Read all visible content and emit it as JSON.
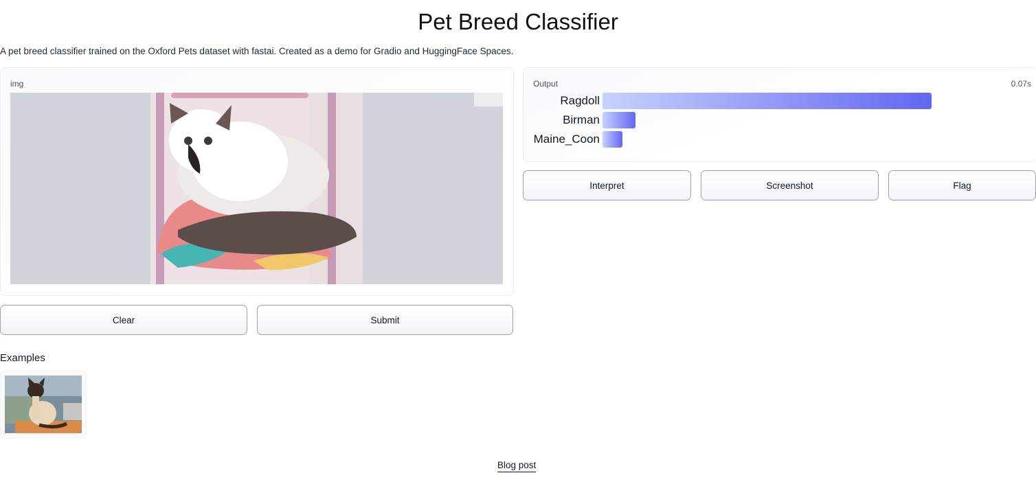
{
  "header": {
    "title": "Pet Breed Classifier",
    "description": "A pet breed classifier trained on the Oxford Pets dataset with fastai. Created as a demo for Gradio and HuggingFace Spaces."
  },
  "input": {
    "label": "img",
    "image_alt": "cat sitting on a chair"
  },
  "output": {
    "label": "Output",
    "timing": "0.07s",
    "bar_color": "#6366f1",
    "predictions": [
      {
        "label": "Ragdoll",
        "confidence": 0.9
      },
      {
        "label": "Birman",
        "confidence": 0.09
      },
      {
        "label": "Maine_Coon",
        "confidence": 0.055
      }
    ]
  },
  "buttons": {
    "clear": "Clear",
    "submit": "Submit",
    "interpret": "Interpret",
    "screenshot": "Screenshot",
    "flag": "Flag"
  },
  "examples": {
    "title": "Examples",
    "items": [
      {
        "image_alt": "siamese cat sitting on a table"
      }
    ]
  },
  "footer": {
    "link": "Blog post"
  }
}
